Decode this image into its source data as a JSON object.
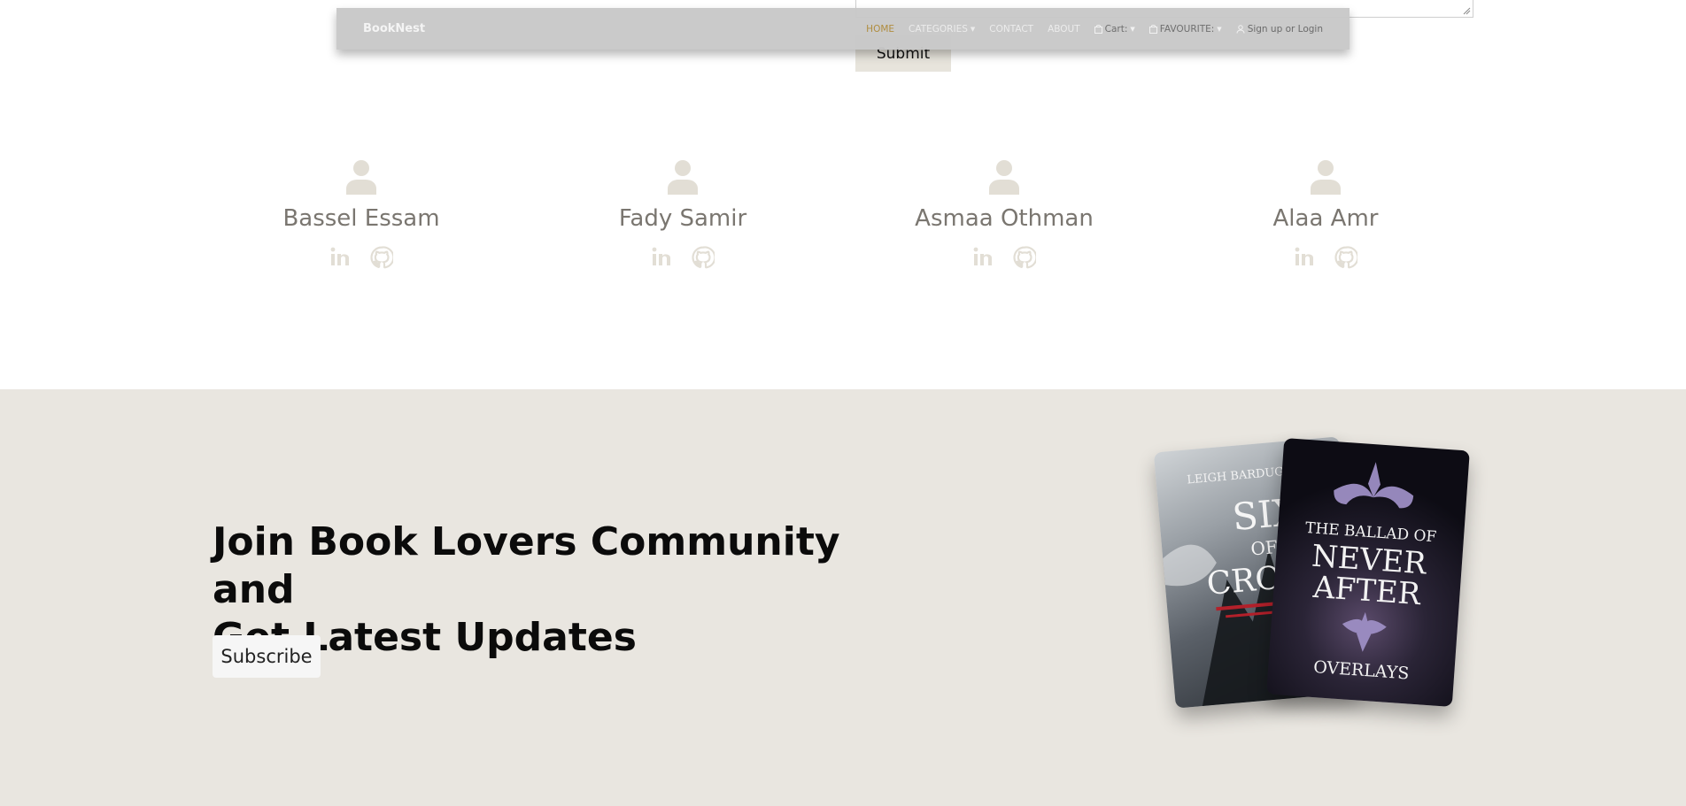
{
  "form": {
    "submit_label": "Submit"
  },
  "navbar": {
    "brand": "BookNest",
    "links": [
      {
        "label": "HOME",
        "active": true
      },
      {
        "label": "CATEGORIES",
        "dropdown": true
      },
      {
        "label": "CONTACT"
      },
      {
        "label": "ABOUT"
      },
      {
        "label": "Cart:",
        "icon": "bag-icon",
        "dropdown": true
      },
      {
        "label": "FAVOURITE:",
        "icon": "bag-icon",
        "dropdown": true
      },
      {
        "label": "Sign up or Login",
        "icon": "user-icon"
      }
    ],
    "accent_color": "#b08d3f"
  },
  "team": {
    "members": [
      {
        "name": "Bassel Essam",
        "icons": [
          "linkedin-icon",
          "github-icon"
        ]
      },
      {
        "name": "Fady Samir",
        "icons": [
          "linkedin-icon",
          "github-icon"
        ]
      },
      {
        "name": "Asmaa Othman",
        "icons": [
          "linkedin-icon",
          "github-icon"
        ]
      },
      {
        "name": "Alaa Amr",
        "icons": [
          "linkedin-icon",
          "github-icon"
        ]
      }
    ],
    "icon_color": "#e2ded5"
  },
  "subscribe": {
    "heading_line1": "Join Book Lovers Community and",
    "heading_line2": "Get Latest Updates",
    "button_label": "Subscribe",
    "background": "#e9e6e0"
  },
  "books": [
    {
      "author": "LEIGH BARDUGO",
      "title_line1": "SIX",
      "title_line2": "OF",
      "title_line3": "CROWS"
    },
    {
      "title_line1": "THE BALLAD OF",
      "title_line2": "NEVER",
      "title_line3": "AFTER",
      "author": "OVERLAYS"
    }
  ]
}
